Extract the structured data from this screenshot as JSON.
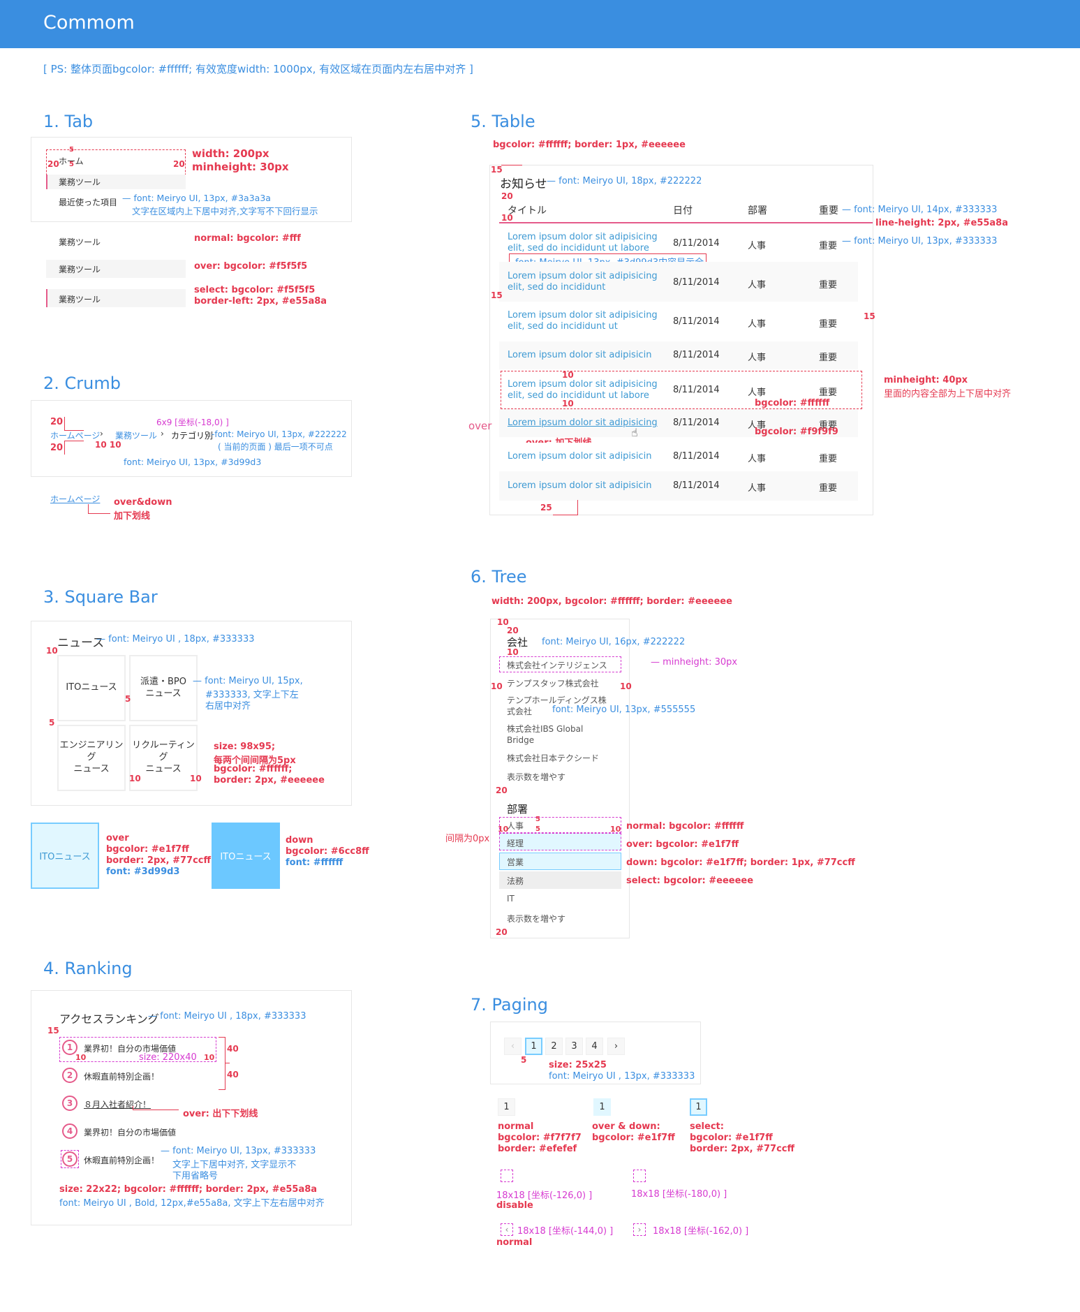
{
  "header": {
    "title": "Commom"
  },
  "ps": "[ PS: 整体页面bgcolor: #ffffff; 有效宽度width: 1000px, 有效区域在页面内左右居中对齐 ]",
  "tab": {
    "title": "1. Tab",
    "home": "ホーム",
    "item1": "業務ツール",
    "item2": "最近使った項目",
    "n5a": "5",
    "n20a": "20",
    "n5b": "5",
    "n20b": "20",
    "ann_width": "width: 200px",
    "ann_minh": "minheight: 30px",
    "ann_font": "font: Meiryo UI, 13px, #3a3a3a",
    "ann_align": "文字在区域内上下居中对齐,文字写不下回行显示",
    "state_normal": "業務ツール",
    "state_over": "業務ツール",
    "state_select": "業務ツール",
    "ann_normal": "normal: bgcolor: #fff",
    "ann_over": "over: bgcolor: #f5f5f5",
    "ann_select1": "select: bgcolor: #f5f5f5",
    "ann_select2": "border-left: 2px, #e55a8a"
  },
  "crumb": {
    "title": "2. Crumb",
    "n20a": "20",
    "n20b": "20",
    "n10a": "10 10",
    "home": "ホームページ",
    "sep1": "›",
    "mid": "業務ツール",
    "sep2": "›",
    "current": "カテゴリ別",
    "ann_icon": "6x9 [坐标(-18,0) ]",
    "ann_cur": "font: Meiryo UI, 13px, #222222",
    "ann_cur2": "( 当前的页面 ) 最后一项不可点",
    "ann_link": "font: Meiryo UI, 13px, #3d99d3",
    "over_link": "ホームページ",
    "ann_over1": "over&down",
    "ann_over2": "加下划线"
  },
  "square": {
    "title": "3. Square Bar",
    "heading": "ニュース",
    "ann_head": "font: Meiryo UI , 18px, #333333",
    "n10": "10",
    "n5a": "5",
    "n5b": "5",
    "n10b": "10",
    "n10c": "10",
    "items": [
      "ITOニュース",
      "派遣・BPO\nニュース",
      "エンジニアリング\nニュース",
      "リクルーティング\nニュース"
    ],
    "ann_font1": "font: Meiryo UI, 15px,",
    "ann_font2": "#333333, 文字上下左",
    "ann_font3": "右居中对齐",
    "ann_size1": "size: 98x95;",
    "ann_size2": "每两个间间隔为5px",
    "ann_size3": "bgcolor: #ffffff;",
    "ann_size4": "border: 2px, #eeeeee",
    "over_label": "ITOニュース",
    "down_label": "ITOニュース",
    "ann_over1": "over",
    "ann_over2": "bgcolor: #e1f7ff",
    "ann_over3": "border: 2px, #77ccff",
    "ann_over4": "font: #3d99d3",
    "ann_down1": "down",
    "ann_down2": "bgcolor: #6cc8ff",
    "ann_down3": "font: #ffffff"
  },
  "ranking": {
    "title": "4. Ranking",
    "heading": "アクセスランキング",
    "ann_head": "— font: Meiryo UI , 18px, #333333",
    "n15": "15",
    "n10a": "10",
    "n10b": "10",
    "n40a": "40",
    "n40b": "40",
    "items": [
      {
        "n": "1",
        "t": "業界初！自分の市場価値"
      },
      {
        "n": "2",
        "t": "休暇直前特別企画！"
      },
      {
        "n": "3",
        "t": "８月入社者紹介！"
      },
      {
        "n": "4",
        "t": "業界初！自分の市場価値"
      },
      {
        "n": "5",
        "t": "休暇直前特別企画！"
      }
    ],
    "ann_size": "size: 220x40",
    "ann_over": "over: 出下下划线",
    "ann_font1": "font: Meiryo UI, 13px, #333333",
    "ann_font2": "文字上下居中对齐, 文字显示不",
    "ann_font3": "下用省略号",
    "ann_circ1": "size: 22x22; bgcolor: #ffffff; border: 2px, #e55a8a",
    "ann_circ2": "font: Meiryo UI , Bold,  12px,#e55a8a, 文字上下左右居中对齐"
  },
  "table": {
    "title": "5. Table",
    "ann_bg": "bgcolor: #ffffff; border: 1px, #eeeeee",
    "n15a": "15",
    "n20": "20",
    "n10": "10",
    "n15b": "15",
    "n15c": "15",
    "n25": "25",
    "n10b": "10",
    "n10c": "10",
    "heading": "お知らせ",
    "ann_head": "— font: Meiryo UI, 18px, #222222",
    "headers": [
      "タイトル",
      "日付",
      "部署",
      "重要"
    ],
    "ann_hdr": "— font: Meiryo UI, 14px, #333333",
    "ann_lh": "line-height: 2px, #e55a8a",
    "ann_cell": "— font: Meiryo UI, 13px, #333333",
    "ann_link": "font: Meiryo UI, 13px, #3d99d3内容显示全",
    "rows": [
      {
        "title": "Lorem ipsum dolor sit adipisicing\nelit, sed do incididunt ut labore",
        "date": "8/11/2014",
        "dept": "人事",
        "imp": "重要"
      },
      {
        "title": "Lorem ipsum dolor sit adipisicing\nelit, sed do incididunt",
        "date": "8/11/2014",
        "dept": "人事",
        "imp": "重要"
      },
      {
        "title": "Lorem ipsum dolor sit adipisicing\nelit, sed do incididunt ut",
        "date": "8/11/2014",
        "dept": "人事",
        "imp": "重要"
      },
      {
        "title": "Lorem ipsum dolor sit adipisicin",
        "date": "8/11/2014",
        "dept": "人事",
        "imp": "重要"
      },
      {
        "title": "Lorem ipsum dolor sit adipisicing\nelit, sed do incididunt ut labore",
        "date": "8/11/2014",
        "dept": "人事",
        "imp": "重要"
      },
      {
        "title": "Lorem ipsum dolor sit adipisicing",
        "date": "8/11/2014",
        "dept": "人事",
        "imp": "重要"
      },
      {
        "title": "Lorem ipsum dolor sit adipisicin",
        "date": "8/11/2014",
        "dept": "人事",
        "imp": "重要"
      },
      {
        "title": "Lorem ipsum dolor sit adipisicin",
        "date": "8/11/2014",
        "dept": "人事",
        "imp": "重要"
      }
    ],
    "ann_minh1": "minheight: 40px",
    "ann_minh2": "里面的内容全部为上下居中对齐",
    "ann_bgw": "bgcolor: #ffffff",
    "ann_bgg": "bgcolor: #f9f9f9",
    "over_side": "over",
    "ann_over": "over: 加下划线"
  },
  "tree": {
    "title": "6. Tree",
    "ann_w": "width: 200px, bgcolor: #ffffff; border: #eeeeee",
    "n10a": "10",
    "n20a": "20",
    "n10b": "10",
    "n10c": "10",
    "n10d": "10",
    "n20b": "20",
    "n10e": "10",
    "n5a": "5",
    "n5b": "5",
    "n10f": "10",
    "n20c": "20",
    "g1": "会社",
    "ann_g1": "font: Meiryo UI, 16px, #222222",
    "g1items": [
      "株式会社インテリジェンス",
      "テンプスタッフ株式会社",
      "テンプホールディングス株\n式会社",
      "株式会社IBS Global\nBridge",
      "株式会社日本テクシード",
      "表示数を増やす"
    ],
    "ann_minh": "minheight: 30px",
    "ann_font": "font: Meiryo UI, 13px, #555555",
    "g2": "部署",
    "g2items": [
      "人事",
      "経理",
      "営業",
      "法務",
      "IT",
      "表示数を増やす"
    ],
    "ann_gap": "间隔为0px",
    "ann_normal": "normal: bgcolor: #ffffff",
    "ann_over": "over: bgcolor: #e1f7ff",
    "ann_down": "down: bgcolor: #e1f7ff; border: 1px, #77ccff",
    "ann_select": "select: bgcolor: #eeeeee"
  },
  "paging": {
    "title": "7. Paging",
    "prev": "‹",
    "pages": [
      "1",
      "2",
      "3",
      "4"
    ],
    "next": "›",
    "n5": "5",
    "ann_size": "size: 25x25",
    "ann_font": "font: Meiryo UI , 13px, #333333",
    "s_normal": "1",
    "s_over": "1",
    "s_select": "1",
    "ann_n1": "normal",
    "ann_n2": "bgcolor: #f7f7f7",
    "ann_n3": "border: #efefef",
    "ann_o1": "over & down:",
    "ann_o2": "bgcolor: #e1f7ff",
    "ann_s1": "select:",
    "ann_s2": "bgcolor: #e1f7ff",
    "ann_s3": "border: 2px, #77ccff",
    "icon1": "18x18 [坐标(-126,0) ]",
    "icon2": "18x18 [坐标(-180,0) ]",
    "icon3": "18x18 [坐标(-144,0) ]",
    "icon4": "18x18 [坐标(-162,0) ]",
    "lbl_disable": "disable",
    "lbl_normal": "normal"
  },
  "colors": {
    "header": "#3a8ee0",
    "link": "#3d99d3",
    "accent": "#e55a8a",
    "annot": "#e53950",
    "magenta": "#d63ad0"
  }
}
